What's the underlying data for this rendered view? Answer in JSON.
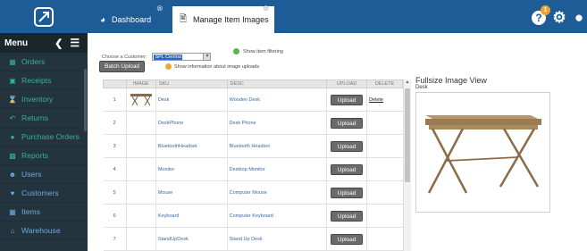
{
  "tabs": [
    {
      "label": "Dashboard",
      "icon": "dashboard-icon",
      "active": false
    },
    {
      "label": "Manage Item Images",
      "icon": "image-icon",
      "active": true
    }
  ],
  "notifications": {
    "count": "1"
  },
  "sidebar": {
    "menu_title": "Menu",
    "items": [
      {
        "label": "Orders",
        "icon": "sitemap-icon",
        "color": "#37b38a"
      },
      {
        "label": "Receipts",
        "icon": "file-icon",
        "color": "#37b38a"
      },
      {
        "label": "Inventory",
        "icon": "hourglass-icon",
        "color": "#37b38a"
      },
      {
        "label": "Returns",
        "icon": "reply-icon",
        "color": "#37b38a"
      },
      {
        "label": "Purchase Orders",
        "icon": "circle-icon",
        "color": "#37b38a"
      },
      {
        "label": "Reports",
        "icon": "table-icon",
        "color": "#37b38a"
      },
      {
        "label": "Users",
        "icon": "users-icon",
        "color": "#6ca8dd"
      },
      {
        "label": "Customers",
        "icon": "handshake-icon",
        "color": "#6ca8dd"
      },
      {
        "label": "Items",
        "icon": "grid-icon",
        "color": "#6ca8dd"
      },
      {
        "label": "Warehouse",
        "icon": "home-icon",
        "color": "#6ca8dd"
      }
    ]
  },
  "controls": {
    "customer_label": "Choose a Customer:",
    "customer_value": "SPL Central",
    "filter_label": "Show item filtering",
    "batch_label": "Batch Upload",
    "info_label": "Show information about image uploads"
  },
  "table": {
    "headers": {
      "image": "IMAGE",
      "sku": "SKU",
      "desc": "DESC",
      "upload": "UPLOAD",
      "delete": "DELETE"
    },
    "upload_label": "Upload",
    "delete_label": "Delete",
    "rows": [
      {
        "num": "1",
        "sku": "Desk",
        "desc": "Wooden Desk",
        "has_image": true,
        "has_delete": true
      },
      {
        "num": "2",
        "sku": "DeskPhone",
        "desc": "Desk Phone",
        "has_image": false,
        "has_delete": false
      },
      {
        "num": "3",
        "sku": "BluetoothHeadset",
        "desc": "Bluetooth Headset",
        "has_image": false,
        "has_delete": false
      },
      {
        "num": "4",
        "sku": "Monitor",
        "desc": "Desktop Monitor",
        "has_image": false,
        "has_delete": false
      },
      {
        "num": "5",
        "sku": "Mouse",
        "desc": "Computer Mouse",
        "has_image": false,
        "has_delete": false
      },
      {
        "num": "6",
        "sku": "Keyboard",
        "desc": "Computer Keyboard",
        "has_image": false,
        "has_delete": false
      },
      {
        "num": "7",
        "sku": "StandUpDesk",
        "desc": "Stand Up Desk",
        "has_image": false,
        "has_delete": false
      }
    ]
  },
  "fullsize": {
    "title": "Fullsize Image View",
    "subtitle": "Desk"
  }
}
